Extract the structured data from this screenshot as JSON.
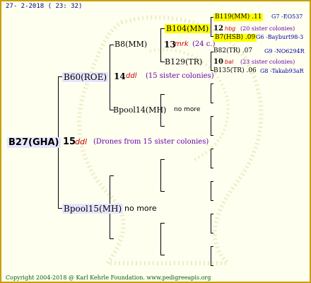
{
  "header": {
    "date": "27- 2-2018 ( 23: 32)"
  },
  "footer": {
    "copyright": "Copyright 2004-2018 @ Karl Kehrle Foundation.   www.pedigreeapis.org"
  },
  "colors": {
    "border": "#c8a000",
    "background": "#fffff0",
    "highlight_yellow": "#ffff00",
    "highlight_lavender": "#e6e6ff",
    "red_annotation": "#cc0000",
    "navy_text": "#000080"
  },
  "pedigree": {
    "root": {
      "name": "B27(GHA)"
    },
    "generation_note": {
      "count": "15",
      "mark": "ddl",
      "note": "(Drones from 15 sister colonies)"
    },
    "father": {
      "name": "B60(ROE)",
      "count": "14",
      "mark": "ddl",
      "note": "(15 sister colonies)"
    },
    "mother": {
      "name": "Bpool15(MH)",
      "note": "no more"
    },
    "ff": {
      "name": "B8(MM)",
      "count": "13",
      "mark": "mrk",
      "note": "(24 c.)"
    },
    "fm": {
      "name": "Bpool14(MH)",
      "note": "no more"
    },
    "fff": {
      "name": "B104(MM)",
      "count": "12",
      "mark": "hbg",
      "note": "(20 sister colonies)"
    },
    "ffm": {
      "name": "B129(TR)",
      "count": "10",
      "mark": "bal",
      "note": "(23 sister colonies)"
    },
    "gen4": [
      {
        "name": "B119(MM)",
        "value": ".11",
        "code": "G7 -EO537"
      },
      {
        "name": "B7(HSB)",
        "value": ".09",
        "code": "G6 -Bayburt98-3"
      },
      {
        "name": "B82(TR)",
        "value": ".07",
        "code": "G9 -NO6294R"
      },
      {
        "name": "B135(TR)",
        "value": ".06",
        "code": "G8 -Takab93aR"
      }
    ]
  }
}
